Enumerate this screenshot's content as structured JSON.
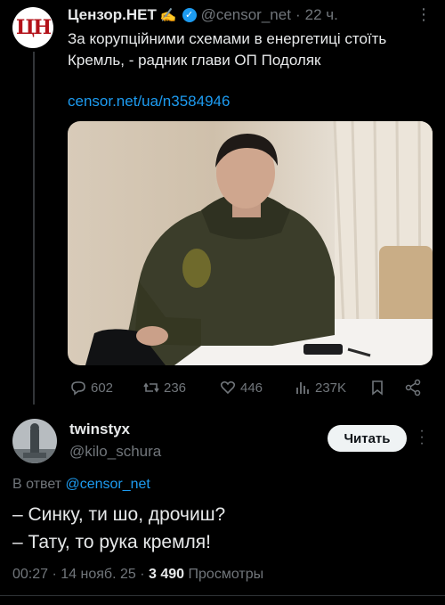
{
  "tweet": {
    "author_name": "Цензор.НЕТ",
    "author_emoji": "✍️",
    "handle": "@censor_net",
    "separator": "·",
    "time": "22 ч.",
    "avatar_text": "ЦН",
    "text": "За корупційними схемами в енергетиці стоїть Кремль, - радник глави ОП Подоляк",
    "link": "censor.net/ua/n3584946",
    "stats": {
      "replies": "602",
      "reposts": "236",
      "likes": "446",
      "views": "237K"
    }
  },
  "reply": {
    "author_name": "twinstyx",
    "handle": "@kilo_schura",
    "follow_label": "Читать",
    "reply_to_prefix": "В ответ",
    "reply_to_mention": "@censor_net",
    "line1": "– Синку, ти шо, дрочиш?",
    "line2": "– Тату, то рука кремля!",
    "meta_time": "00:27",
    "meta_date": "14 нояб. 25",
    "meta_sep": "·",
    "views_count": "3 490",
    "views_label": "Просмотры"
  },
  "colors": {
    "accent": "#1d9bf0",
    "background": "#000000",
    "secondary_text": "#71767b",
    "primary_text": "#e7e9ea"
  }
}
